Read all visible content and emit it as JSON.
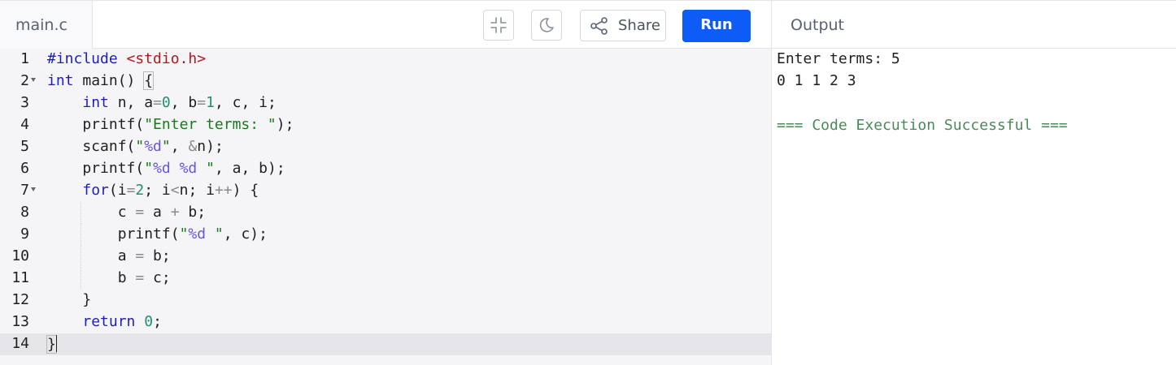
{
  "file_tab": {
    "label": "main.c"
  },
  "toolbar": {
    "fullscreen_icon": "collapse-icon",
    "theme_icon": "moon-icon",
    "share_icon": "share-icon",
    "share_label": "Share",
    "run_label": "Run",
    "run_color": "#0d5cf6"
  },
  "output": {
    "title": "Output",
    "lines": [
      "Enter terms: 5",
      "0 1 1 2 3",
      "",
      "=== Code Execution Successful ==="
    ]
  },
  "editor": {
    "active_line": 14,
    "lines": [
      {
        "number": "1",
        "text": "#include <stdio.h>"
      },
      {
        "number": "2",
        "text": "int main() {"
      },
      {
        "number": "3",
        "text": "    int n, a=0, b=1, c, i;"
      },
      {
        "number": "4",
        "text": "    printf(\"Enter terms: \");"
      },
      {
        "number": "5",
        "text": "    scanf(\"%d\", &n);"
      },
      {
        "number": "6",
        "text": "    printf(\"%d %d \", a, b);"
      },
      {
        "number": "7",
        "text": "    for(i=2; i<n; i++) {"
      },
      {
        "number": "8",
        "text": "        c = a + b;"
      },
      {
        "number": "9",
        "text": "        printf(\"%d \", c);"
      },
      {
        "number": "10",
        "text": "        a = b;"
      },
      {
        "number": "11",
        "text": "        b = c;"
      },
      {
        "number": "12",
        "text": "    }"
      },
      {
        "number": "13",
        "text": "    return 0;"
      },
      {
        "number": "14",
        "text": "}"
      }
    ]
  }
}
